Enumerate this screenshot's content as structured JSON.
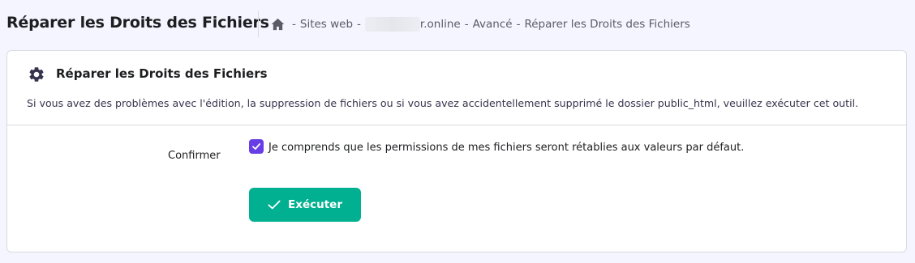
{
  "header": {
    "page_title": "Réparer les Droits des Fichiers",
    "breadcrumb": {
      "home_icon": "home-icon",
      "sep": "-",
      "items": [
        "Sites web",
        "r.online",
        "Avancé",
        "Réparer les Droits des Fichiers"
      ]
    }
  },
  "card": {
    "icon": "gear-icon",
    "title": "Réparer les Droits des Fichiers",
    "description": "Si vous avez des problèmes avec l'édition, la suppression de fichiers ou si vous avez accidentellement supprimé le dossier public_html, veuillez exécuter cet outil.",
    "confirm_label": "Confirmer",
    "checkbox": {
      "checked": true,
      "text": "Je comprends que les permissions de mes fichiers seront rétablies aux valeurs par défaut."
    },
    "execute_button": {
      "icon": "check-icon",
      "label": "Exécuter"
    }
  },
  "colors": {
    "accent_purple": "#673de6",
    "button_green": "#00b090",
    "background": "#f4f5ff"
  }
}
